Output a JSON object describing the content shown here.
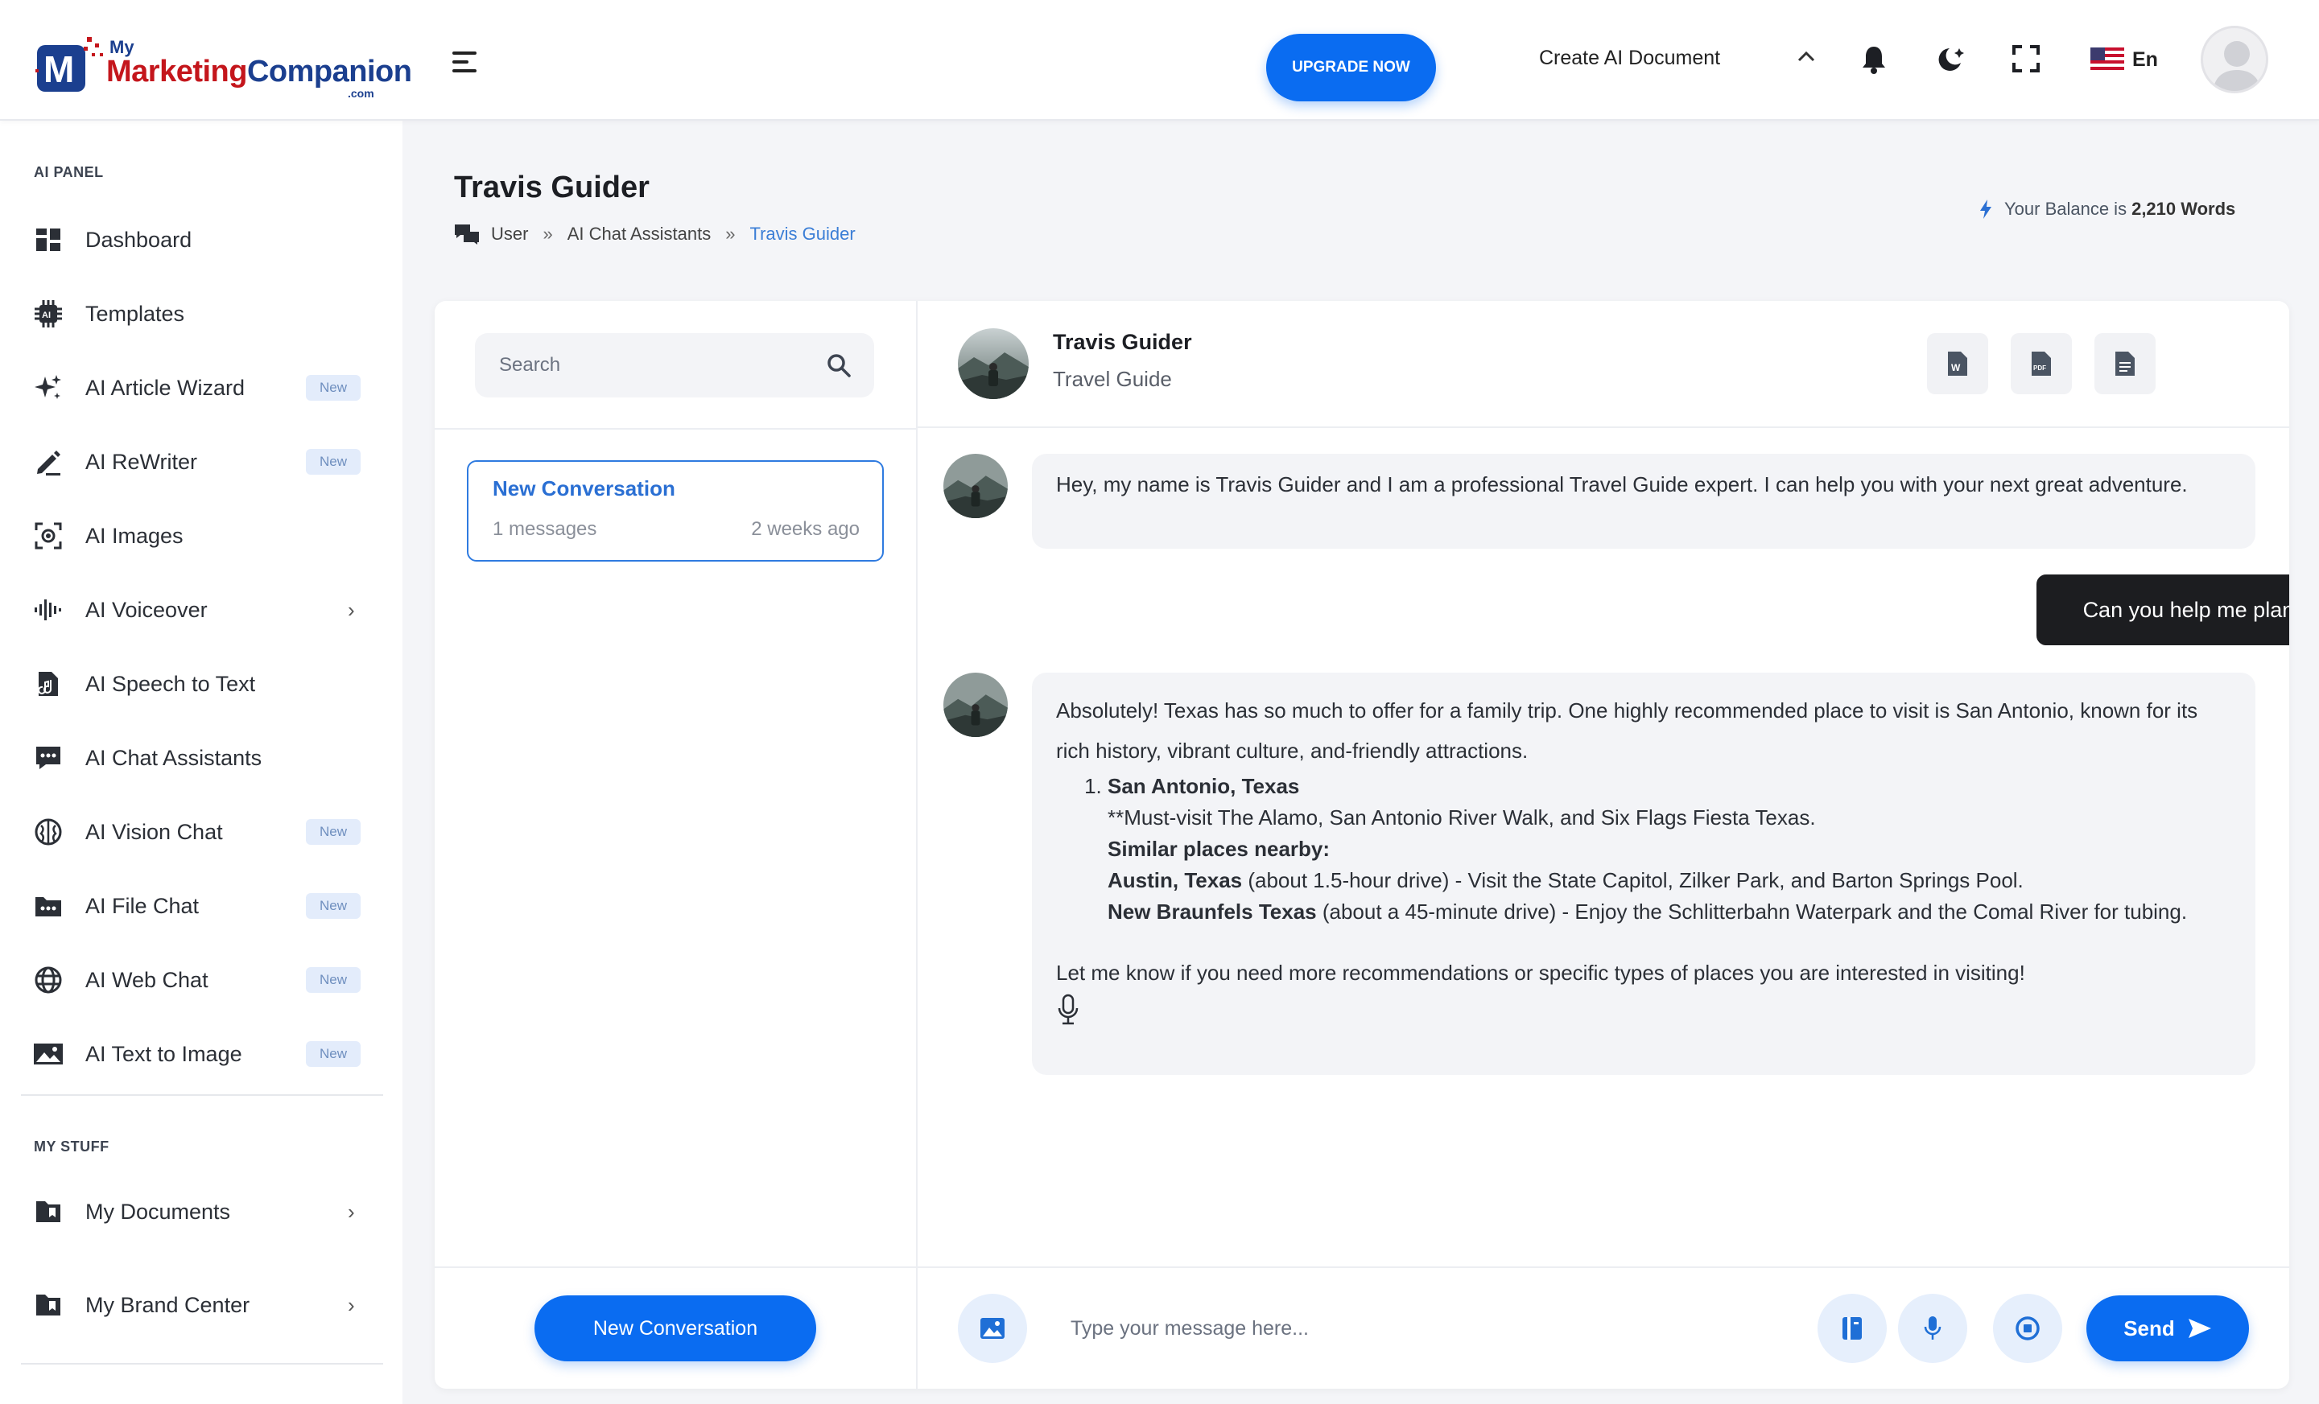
{
  "brand": {
    "logo_my": "My",
    "logo_marketing": "Marketing",
    "logo_companion": "Companion",
    "logo_com": ".com",
    "accent": "#0a6cf1",
    "logo_red": "#c4161c",
    "logo_blue": "#1b3f8f"
  },
  "header": {
    "upgrade_label": "UPGRADE NOW",
    "create_doc_label": "Create AI Document",
    "language": "En"
  },
  "sidebar": {
    "section_ai": "AI PANEL",
    "section_mystuff": "MY STUFF",
    "items": [
      {
        "label": "Dashboard",
        "icon": "dashboard-icon"
      },
      {
        "label": "Templates",
        "icon": "ai-chip-icon"
      },
      {
        "label": "AI Article Wizard",
        "icon": "sparkles-icon",
        "badge": "New"
      },
      {
        "label": "AI ReWriter",
        "icon": "pen-icon",
        "badge": "New"
      },
      {
        "label": "AI Images",
        "icon": "camera-icon"
      },
      {
        "label": "AI Voiceover",
        "icon": "waveform-icon"
      },
      {
        "label": "AI Speech to Text",
        "icon": "music-file-icon"
      },
      {
        "label": "AI Chat Assistants",
        "icon": "chat-icon"
      },
      {
        "label": "AI Vision Chat",
        "icon": "brain-icon",
        "badge": "New"
      },
      {
        "label": "AI File Chat",
        "icon": "file-chat-icon",
        "badge": "New"
      },
      {
        "label": "AI Web Chat",
        "icon": "globe-icon",
        "badge": "New"
      },
      {
        "label": "AI Text to Image",
        "icon": "image-icon",
        "badge": "New"
      }
    ],
    "mystuff": [
      {
        "label": "My Documents",
        "icon": "folder-icon"
      },
      {
        "label": "My Brand Center",
        "icon": "folder-icon"
      }
    ]
  },
  "page": {
    "title": "Travis Guider",
    "breadcrumb": [
      "User",
      "AI Chat Assistants",
      "Travis Guider"
    ],
    "breadcrumb_sep": "»",
    "balance_prefix": "Your Balance is",
    "balance_value": "2,210 Words"
  },
  "conversations": {
    "search_placeholder": "Search",
    "items": [
      {
        "title": "New Conversation",
        "messages": "1 messages",
        "when": "2 weeks ago"
      }
    ],
    "new_button": "New Conversation"
  },
  "chat": {
    "assistant_name": "Travis Guider",
    "assistant_role": "Travel Guide",
    "greeting": "Hey, my name is Travis Guider and I am a professional Travel Guide expert. I can help you with your next great adventure.",
    "user_message": "Can you help me planning a family tour to Texas?",
    "reply": {
      "intro": "Absolutely! Texas has so much to offer for a family trip. One highly recommended place to visit is San Antonio, known for its rich history, vibrant culture, and-friendly attractions.",
      "place_title": "San Antonio, Texas",
      "must_visit": "**Must-visit The Alamo, San Antonio River Walk, and Six Flags Fiesta Texas.",
      "similar_heading": "Similar places nearby:",
      "austin_name": "Austin, Texas",
      "austin_text": " (about 1.5-hour drive) - Visit the State Capitol, Zilker Park, and Barton Springs Pool.",
      "braunfels_name": "New Braunfels Texas",
      "braunfels_text": " (about a 45-minute drive) - Enjoy the Schlitterbahn Waterpark and the Comal River for tubing.",
      "outro": "Let me know if you need more recommendations or specific types of places you are interested in visiting!"
    },
    "input_placeholder": "Type your message here...",
    "send_label": "Send"
  }
}
